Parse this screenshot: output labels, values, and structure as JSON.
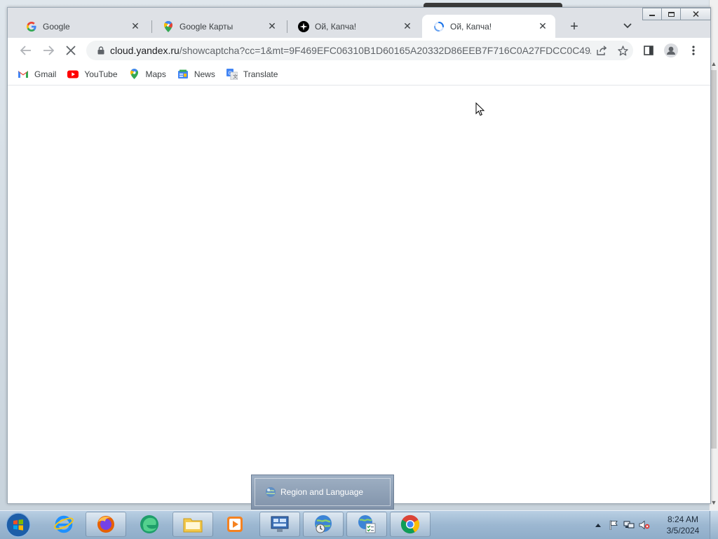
{
  "browser": {
    "tabs": [
      {
        "title": "Google",
        "favicon": "google-g-icon",
        "active": false
      },
      {
        "title": "Google Карты",
        "favicon": "maps-pin-icon",
        "active": false
      },
      {
        "title": "Ой, Капча!",
        "favicon": "yandex-star-icon",
        "active": false
      },
      {
        "title": "Ой, Капча!",
        "favicon": "loading-spinner-icon",
        "active": true
      }
    ],
    "close_glyph": "✕",
    "new_tab_glyph": "+",
    "address": {
      "host": "cloud.yandex.ru",
      "path": "/showcaptcha?cc=1&mt=9F469EFC06310B1D60165A20332D86EEB7F716C0A27FDCC0C49A..."
    },
    "bookmarks": [
      {
        "label": "Gmail",
        "icon": "gmail-icon"
      },
      {
        "label": "YouTube",
        "icon": "youtube-icon"
      },
      {
        "label": "Maps",
        "icon": "maps-pin-icon"
      },
      {
        "label": "News",
        "icon": "news-icon"
      },
      {
        "label": "Translate",
        "icon": "translate-icon"
      }
    ]
  },
  "taskbar": {
    "popup_title": "Region and Language",
    "apps": [
      {
        "name": "internet-explorer",
        "running": false
      },
      {
        "name": "firefox",
        "running": true
      },
      {
        "name": "edge-green",
        "running": false
      },
      {
        "name": "file-explorer",
        "running": true
      },
      {
        "name": "media-player",
        "running": false
      },
      {
        "name": "control-panel",
        "running": true
      },
      {
        "name": "region-language",
        "running": true
      },
      {
        "name": "network-tool",
        "running": true
      },
      {
        "name": "chrome",
        "running": true
      }
    ],
    "clock_time": "8:24 AM",
    "clock_date": "3/5/2024"
  },
  "colors": {
    "tabstrip": "#dee1e6",
    "accent_blue": "#1a73e8",
    "taskbar": "#9cb7d1"
  }
}
